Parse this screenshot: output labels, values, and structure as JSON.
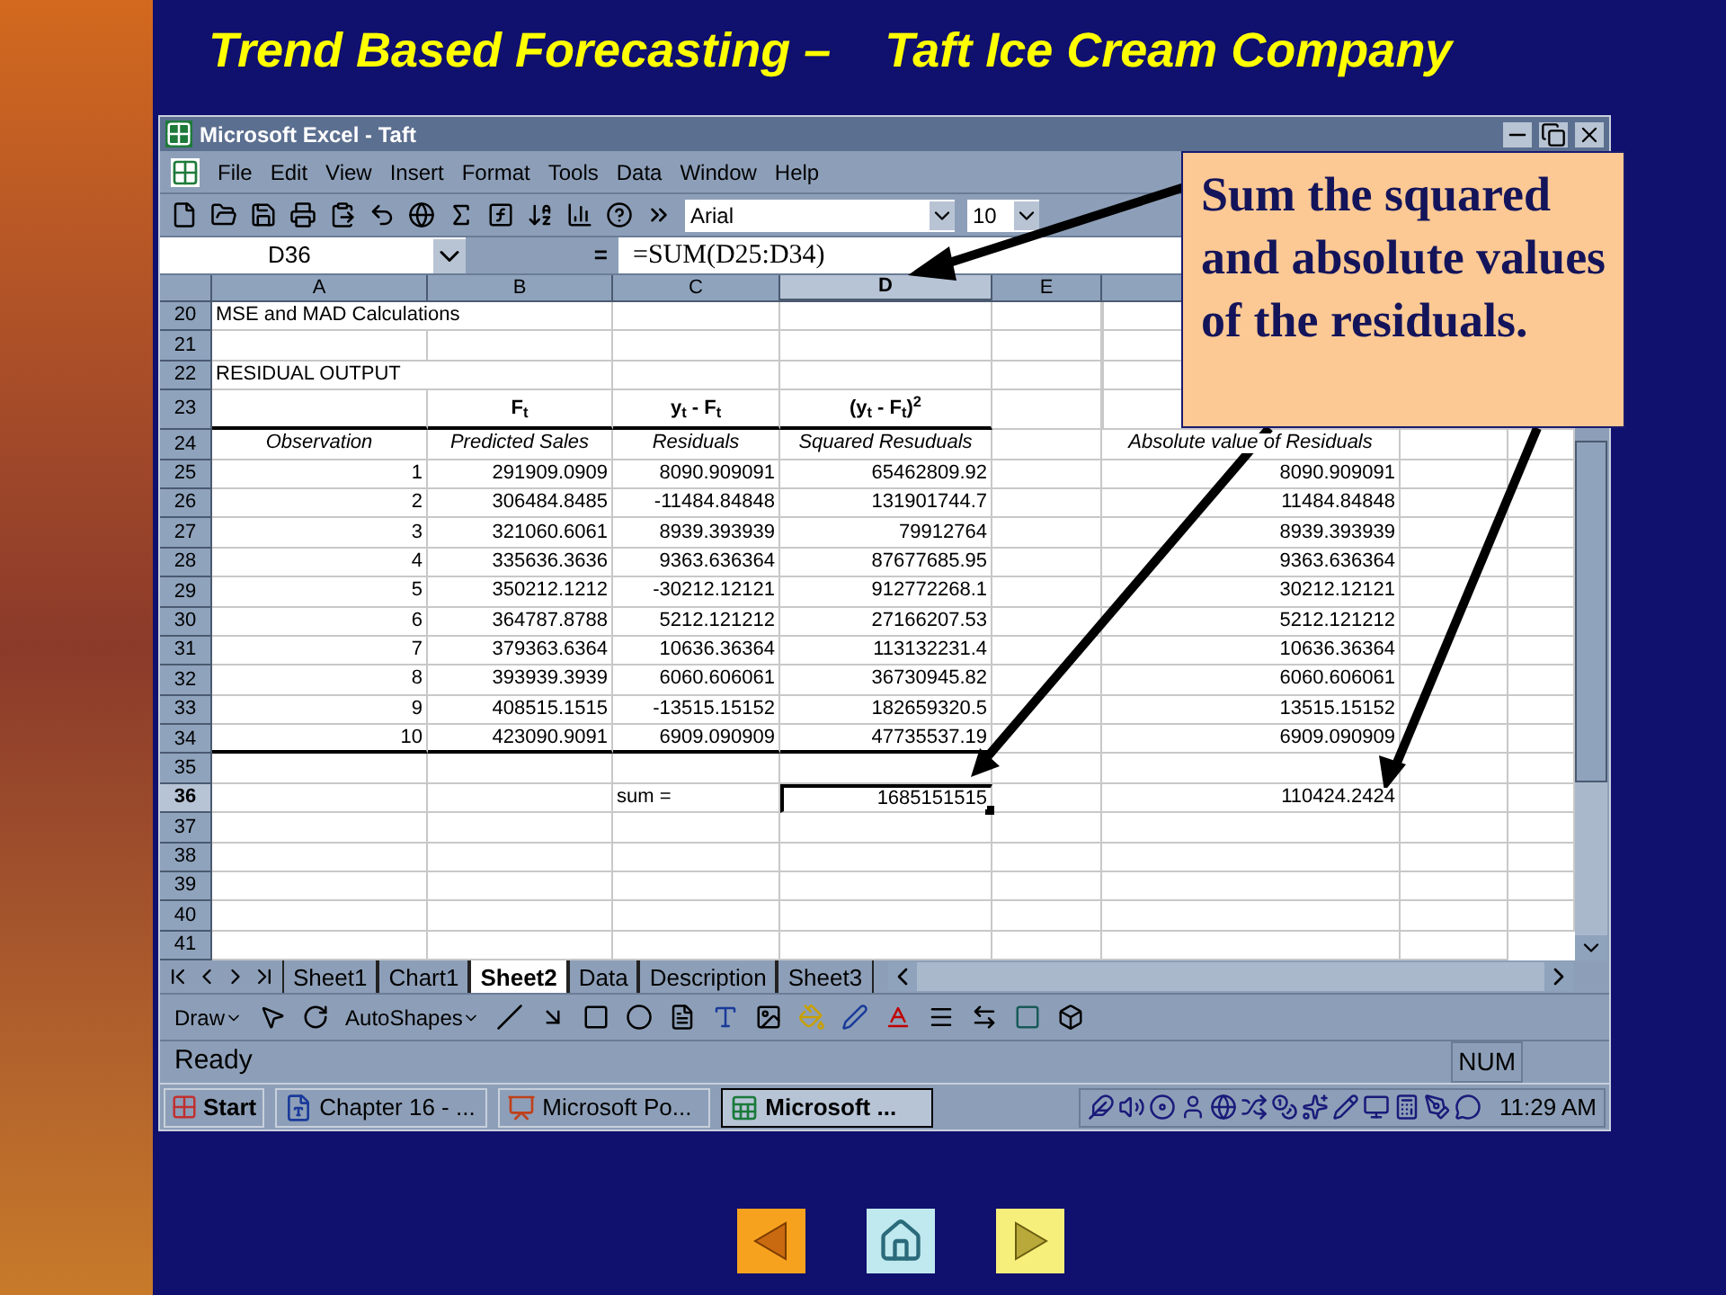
{
  "slide": {
    "title_left": "Trend Based Forecasting –",
    "title_right": "Taft Ice Cream Company",
    "callout": "Sum the squared and absolute values of the residuals.",
    "nav_buttons": [
      {
        "kind": "previous"
      },
      {
        "kind": "home"
      },
      {
        "kind": "next"
      }
    ]
  },
  "window": {
    "title": "Microsoft Excel - Taft",
    "menu": [
      "File",
      "Edit",
      "View",
      "Insert",
      "Format",
      "Tools",
      "Data",
      "Window",
      "Help"
    ],
    "toolbar": {
      "font": "Arial",
      "size": "10"
    },
    "name_box": "D36",
    "formula_equals": "=",
    "formula": "=SUM(D25:D34)",
    "column_headers": [
      {
        "label": "A",
        "selected": false
      },
      {
        "label": "B",
        "selected": false
      },
      {
        "label": "C",
        "selected": false
      },
      {
        "label": "D",
        "selected": true
      },
      {
        "label": "E",
        "selected": false
      }
    ],
    "rows": [
      {
        "number": "20",
        "kind": "title",
        "selected": false,
        "cells": {
          "a": "MSE and MAD Calculations"
        }
      },
      {
        "number": "21",
        "kind": "blank",
        "selected": false,
        "cells": {}
      },
      {
        "number": "22",
        "kind": "title",
        "selected": false,
        "cells": {
          "a": "RESIDUAL OUTPUT"
        }
      },
      {
        "number": "23",
        "kind": "header",
        "selected": false,
        "rule_below": true,
        "cells": {
          "b": "F$_{t}$",
          "c": "y$_{t}$ - F$_{t}$",
          "d": "(y$_{t}$ - F$_{t}$)$^{2}$"
        }
      },
      {
        "number": "24",
        "kind": "subheader",
        "selected": false,
        "cells": {
          "a": "Observation",
          "b": "Predicted Sales",
          "c": "Residuals",
          "d": "Squared Resuduals",
          "f": "Absolute value of Residuals"
        }
      },
      {
        "number": "25",
        "kind": "data",
        "selected": false,
        "cells": {
          "a": "1",
          "b": "291909.0909",
          "c": "8090.909091",
          "d": "65462809.92",
          "f": "8090.909091"
        }
      },
      {
        "number": "26",
        "kind": "data",
        "selected": false,
        "cells": {
          "a": "2",
          "b": "306484.8485",
          "c": "-11484.84848",
          "d": "131901744.7",
          "f": "11484.84848"
        }
      },
      {
        "number": "27",
        "kind": "data",
        "selected": false,
        "cells": {
          "a": "3",
          "b": "321060.6061",
          "c": "8939.393939",
          "d": "79912764",
          "f": "8939.393939"
        }
      },
      {
        "number": "28",
        "kind": "data",
        "selected": false,
        "cells": {
          "a": "4",
          "b": "335636.3636",
          "c": "9363.636364",
          "d": "87677685.95",
          "f": "9363.636364"
        }
      },
      {
        "number": "29",
        "kind": "data",
        "selected": false,
        "cells": {
          "a": "5",
          "b": "350212.1212",
          "c": "-30212.12121",
          "d": "912772268.1",
          "f": "30212.12121"
        }
      },
      {
        "number": "30",
        "kind": "data",
        "selected": false,
        "cells": {
          "a": "6",
          "b": "364787.8788",
          "c": "5212.121212",
          "d": "27166207.53",
          "f": "5212.121212"
        }
      },
      {
        "number": "31",
        "kind": "data",
        "selected": false,
        "cells": {
          "a": "7",
          "b": "379363.6364",
          "c": "10636.36364",
          "d": "113132231.4",
          "f": "10636.36364"
        }
      },
      {
        "number": "32",
        "kind": "data",
        "selected": false,
        "cells": {
          "a": "8",
          "b": "393939.3939",
          "c": "6060.606061",
          "d": "36730945.82",
          "f": "6060.606061"
        }
      },
      {
        "number": "33",
        "kind": "data",
        "selected": false,
        "cells": {
          "a": "9",
          "b": "408515.1515",
          "c": "-13515.15152",
          "d": "182659320.5",
          "f": "13515.15152"
        }
      },
      {
        "number": "34",
        "kind": "data",
        "selected": false,
        "rule_below": true,
        "cells": {
          "a": "10",
          "b": "423090.9091",
          "c": "6909.090909",
          "d": "47735537.19",
          "f": "6909.090909"
        }
      },
      {
        "number": "35",
        "kind": "blank",
        "selected": false,
        "cells": {}
      },
      {
        "number": "36",
        "kind": "sum",
        "selected": true,
        "cells": {
          "c": "sum =",
          "d": "1685151515",
          "f": "110424.2424"
        }
      },
      {
        "number": "37",
        "kind": "blank",
        "selected": false,
        "cells": {}
      },
      {
        "number": "38",
        "kind": "blank",
        "selected": false,
        "cells": {}
      },
      {
        "number": "39",
        "kind": "blank",
        "selected": false,
        "cells": {}
      },
      {
        "number": "40",
        "kind": "blank",
        "selected": false,
        "cells": {}
      },
      {
        "number": "41",
        "kind": "blank",
        "selected": false,
        "cells": {}
      }
    ],
    "sheet_tabs": [
      {
        "label": "Sheet1",
        "selected": false
      },
      {
        "label": "Chart1",
        "selected": false
      },
      {
        "label": "Sheet2",
        "selected": true
      },
      {
        "label": "Data",
        "selected": false
      },
      {
        "label": "Description",
        "selected": false
      },
      {
        "label": "Sheet3",
        "selected": false
      }
    ],
    "drawing_toolbar": {
      "draw": "Draw",
      "autoshapes": "AutoShapes"
    },
    "status_bar": {
      "status": "Ready",
      "num": "NUM"
    },
    "taskbar": {
      "start": "Start",
      "tasks": [
        {
          "label": "Chapter 16 - ...",
          "kind": "word",
          "selected": false
        },
        {
          "label": "Microsoft Po...",
          "kind": "powerpoint",
          "selected": false
        },
        {
          "label": "Microsoft ...",
          "kind": "excel",
          "selected": true
        }
      ],
      "clock": "11:29 AM"
    }
  }
}
